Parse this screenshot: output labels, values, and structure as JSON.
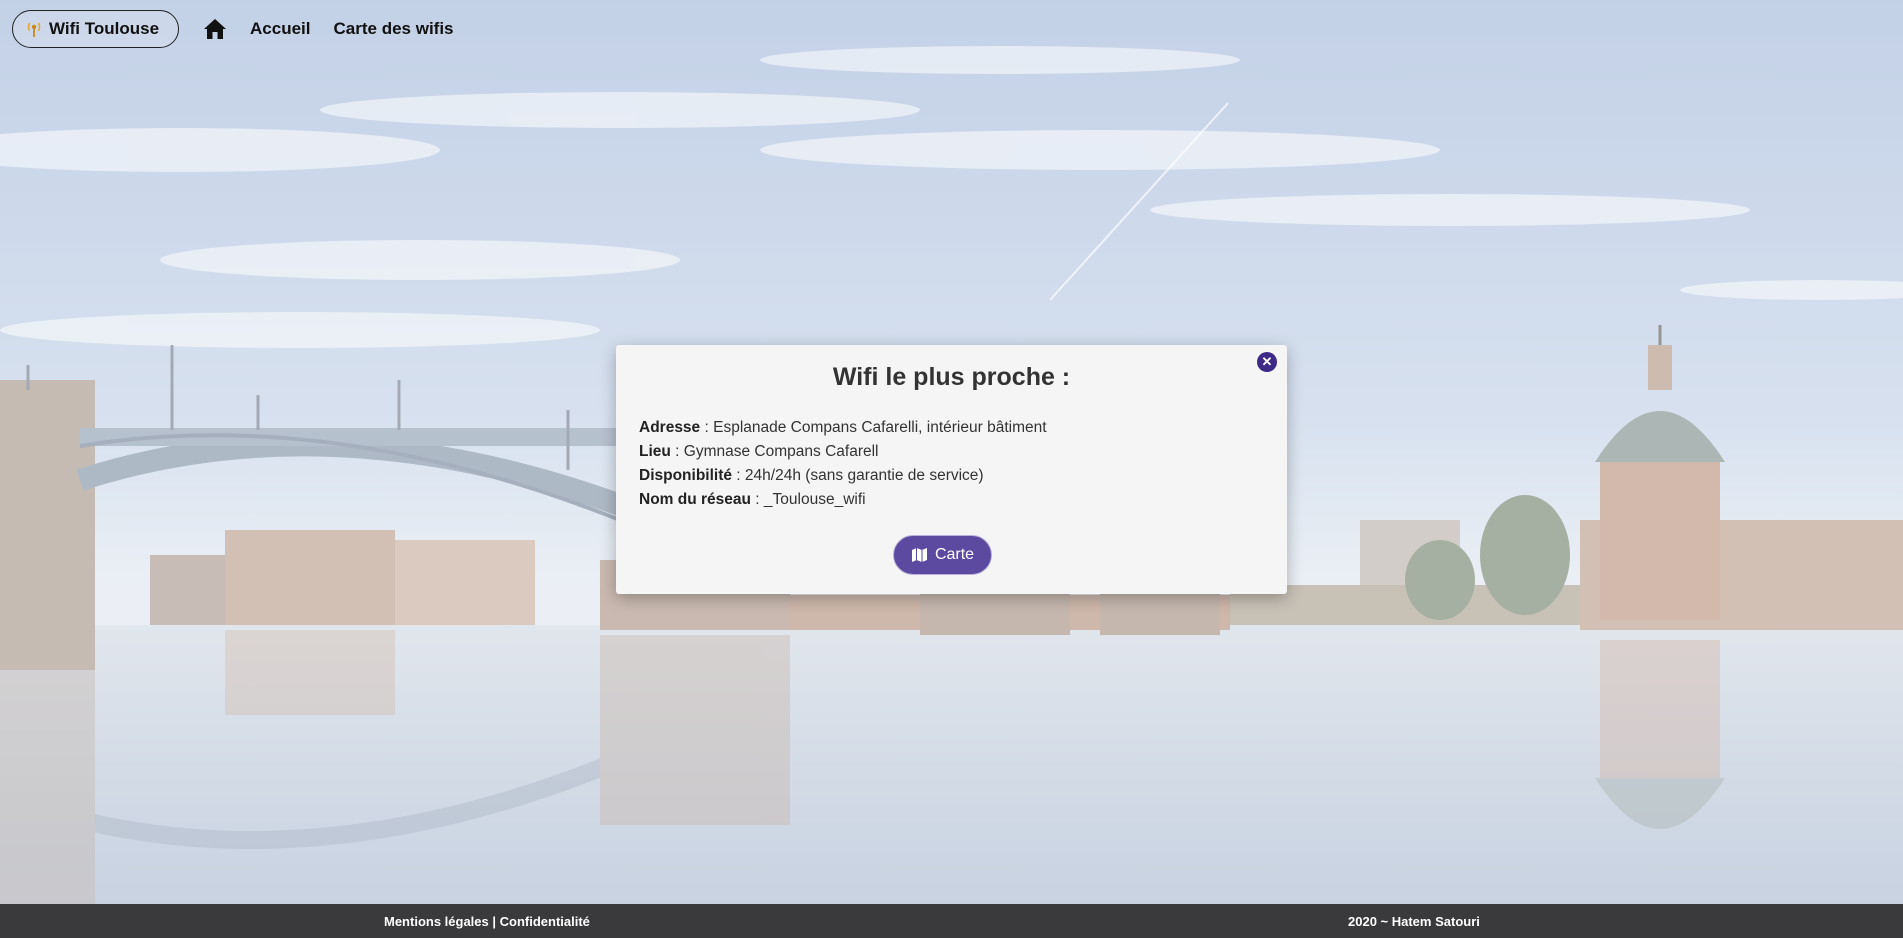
{
  "navbar": {
    "brand_label": "Wifi Toulouse",
    "brand_icon": "wifi-antenna-icon",
    "home_icon": "home-icon",
    "links": [
      "Accueil",
      "Carte des wifis"
    ]
  },
  "modal": {
    "title": "Wifi le plus proche :",
    "close_icon": "close-icon",
    "fields": [
      {
        "label": "Adresse",
        "value": "Esplanade Compans Cafarelli, intérieur bâtiment"
      },
      {
        "label": "Lieu",
        "value": "Gymnase Compans Cafarell"
      },
      {
        "label": "Disponibilité",
        "value": "24h/24h (sans garantie de service)"
      },
      {
        "label": "Nom du réseau",
        "value": "_Toulouse_wifi"
      }
    ],
    "map_button": {
      "label": "Carte",
      "icon": "map-icon"
    }
  },
  "footer": {
    "legal": "Mentions légales",
    "separator": " | ",
    "privacy": "Confidentialité",
    "credit": "2020 ~ Hatem Satouri"
  },
  "colors": {
    "accent": "#5c49a0",
    "close_button": "#3d2a86",
    "footer_bg": "#3a3a3c",
    "modal_bg": "#f5f5f5"
  }
}
